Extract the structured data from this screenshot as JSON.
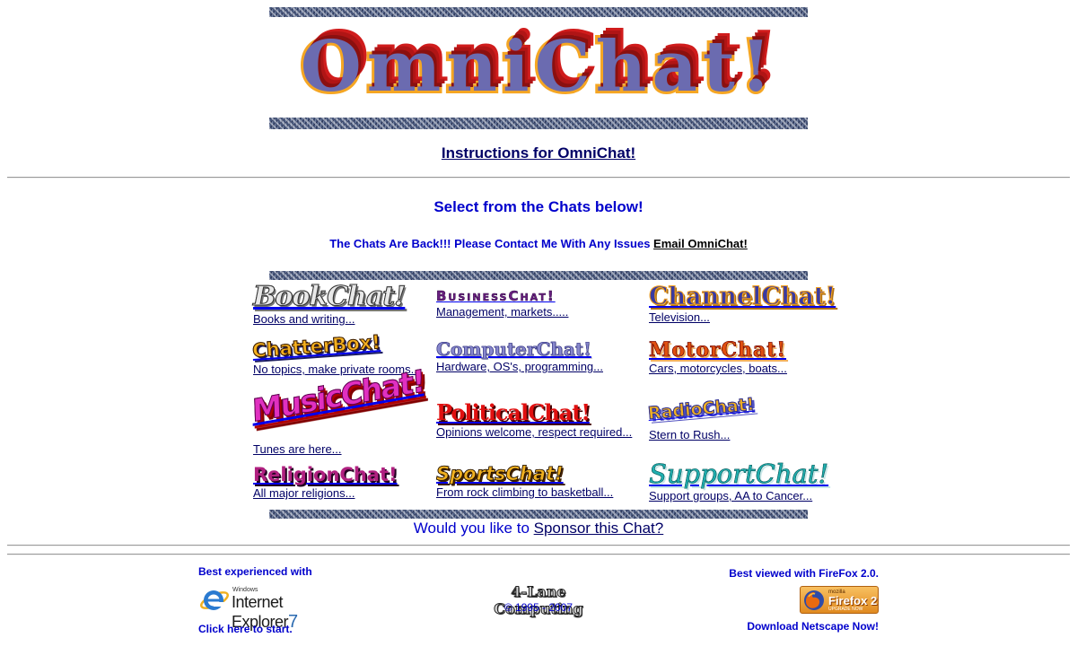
{
  "header": {
    "logo_text": "OmniChat!",
    "instructions_link": "Instructions for OmniChat!"
  },
  "select": {
    "heading": "Select from the Chats below!",
    "notice": "The Chats Are Back!!! Please Contact Me With Any Issues",
    "email_link": "Email OmniChat!"
  },
  "chats": [
    {
      "logo": "BookChat!",
      "desc": "Books and writing..."
    },
    {
      "logo": "BusinessChat!",
      "desc": "Management, markets....."
    },
    {
      "logo": "ChannelChat!",
      "desc": "Television..."
    },
    {
      "logo": "ChatterBox!",
      "desc": "No topics, make private rooms..."
    },
    {
      "logo": "ComputerChat!",
      "desc": "Hardware, OS's, programming..."
    },
    {
      "logo": "MotorChat!",
      "desc": "Cars, motorcycles, boats..."
    },
    {
      "logo": "MusicChat!",
      "desc": "Tunes are here..."
    },
    {
      "logo": "PoliticalChat!",
      "desc": "Opinions welcome, respect required..."
    },
    {
      "logo": "RadioChat!",
      "desc": "Stern to Rush..."
    },
    {
      "logo": "ReligionChat!",
      "desc": "All major religions..."
    },
    {
      "logo": "SportsChat!",
      "desc": "From rock climbing to basketball..."
    },
    {
      "logo": "SupportChat!",
      "desc": "Support groups, AA to Cancer..."
    }
  ],
  "sponsor": {
    "prefix": "Would you like to",
    "link": "Sponsor this Chat?"
  },
  "footer": {
    "ie_heading": "Best experienced with",
    "ie_windows": "Windows",
    "ie_name": "Internet Explorer",
    "ie_version": "7",
    "ie_link": "Click here to start.",
    "company_logo": "4-Lane Computing",
    "copyright": "© 1995 - 2007",
    "ff_heading": "Best viewed with FireFox 2.0.",
    "ff_mozilla": "mozilla",
    "ff_name": "Firefox 2",
    "ff_sub": "UPGRADE NOW",
    "netscape_link": "Download Netscape Now!"
  },
  "colors": {
    "link_blue": "#0000cc",
    "link_dark": "#000066",
    "logo_orange": "#f5a623",
    "logo_red": "#c01818"
  }
}
